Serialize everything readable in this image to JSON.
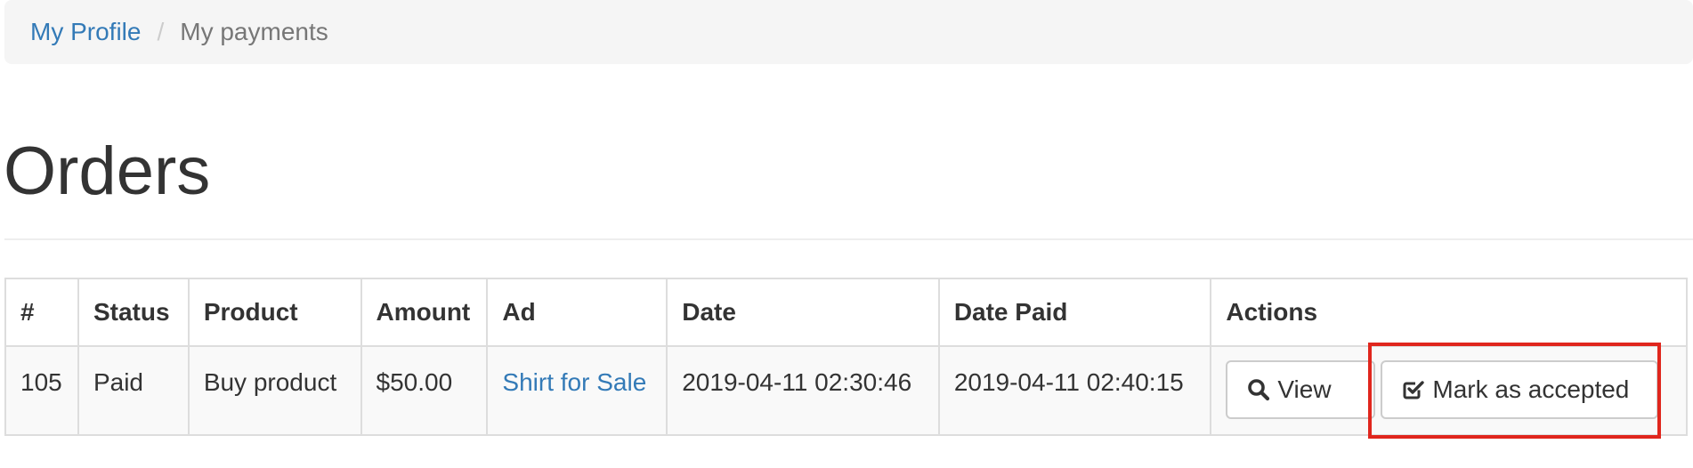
{
  "breadcrumb": {
    "items": [
      {
        "label": "My Profile",
        "link": true
      },
      {
        "label": "My payments",
        "link": false
      }
    ],
    "separator": "/"
  },
  "page": {
    "title": "Orders"
  },
  "table": {
    "headers": [
      "#",
      "Status",
      "Product",
      "Amount",
      "Ad",
      "Date",
      "Date Paid",
      "Actions"
    ],
    "rows": [
      {
        "id": "105",
        "status": "Paid",
        "product": "Buy product",
        "amount": "$50.00",
        "ad": "Shirt for Sale",
        "date": "2019-04-11 02:30:46",
        "date_paid": "2019-04-11 02:40:15",
        "actions": {
          "view_label": "View",
          "view_icon": "search-icon",
          "accept_label": "Mark as accepted",
          "accept_icon": "check-square-icon"
        }
      }
    ]
  },
  "colors": {
    "link": "#337ab7",
    "highlight": "#e0261d",
    "breadcrumb_bg": "#f5f5f5",
    "border": "#dddddd"
  }
}
